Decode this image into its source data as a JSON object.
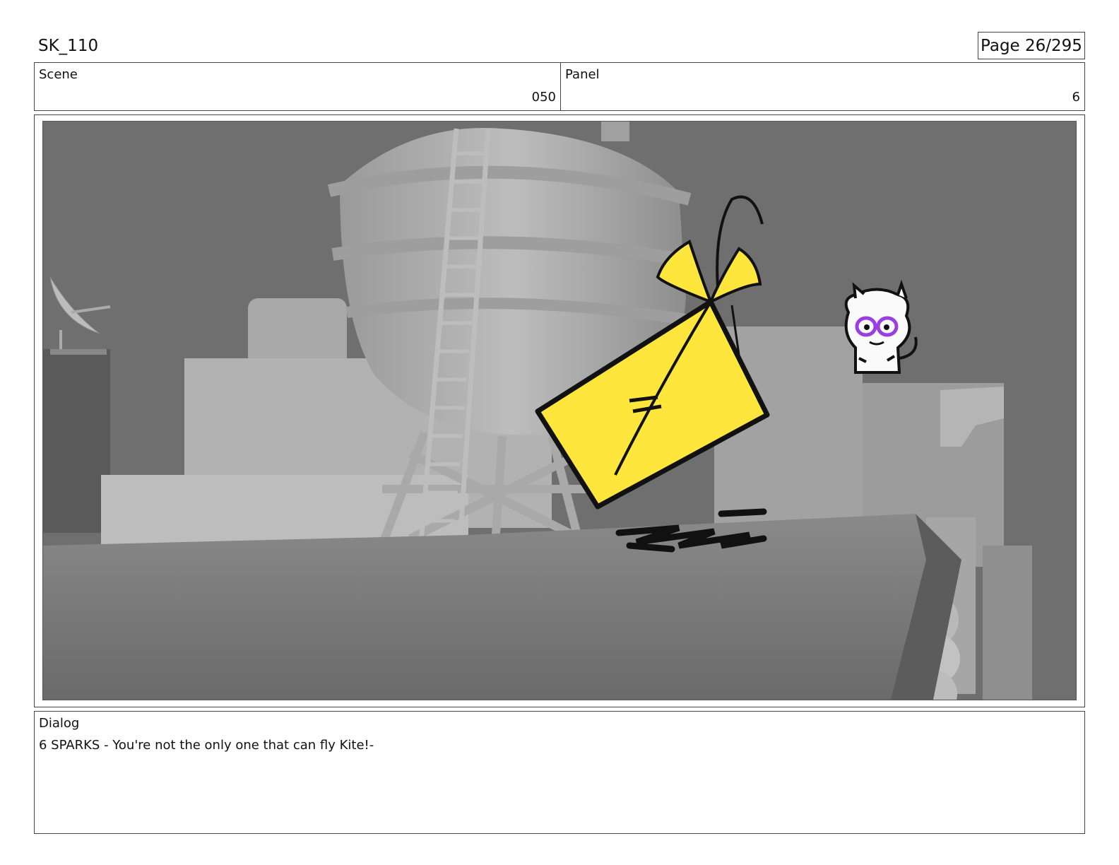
{
  "header": {
    "title": "SK_110",
    "page": "Page  26/295"
  },
  "info": {
    "scene_label": "Scene",
    "scene_value": "050",
    "panel_label": "Panel",
    "panel_value": "6"
  },
  "dialog": {
    "label": "Dialog",
    "text": "6 SPARKS - You're not the only one that can fly Kite!-"
  },
  "colors": {
    "envelope": "#ffe63c",
    "background_grey": "#6f6f6f",
    "character_eye": "#9a3ee0"
  }
}
